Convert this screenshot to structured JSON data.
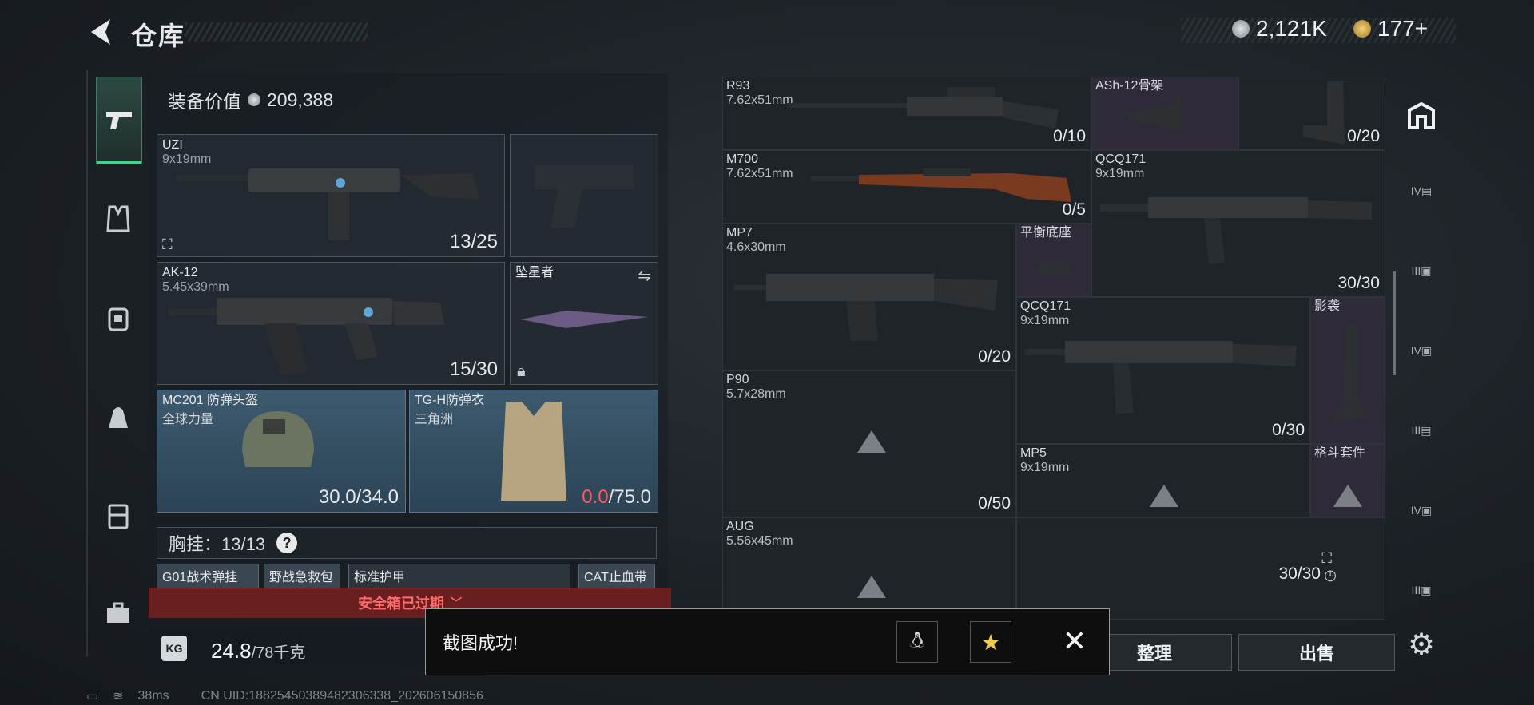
{
  "header": {
    "title": "仓库",
    "silver": "2,121K",
    "gold": "177+"
  },
  "left_panel": {
    "equip_value_label": "装备价值",
    "equip_value": "209,388",
    "slots": {
      "uzi": {
        "name": "UZI",
        "caliber": "9x19mm",
        "count": "13/25"
      },
      "ak12": {
        "name": "AK-12",
        "caliber": "5.45x39mm",
        "count": "15/30"
      },
      "melee": {
        "name": "坠星者"
      },
      "helmet": {
        "name": "MC201 防弹头盔",
        "sub": "全球力量",
        "durability": "30.0",
        "max": "/34.0"
      },
      "armor": {
        "name": "TG-H防弹衣",
        "sub": "三角洲",
        "durability": "0.0",
        "max": "/75.0"
      }
    },
    "chest_rig": "胸挂：13/13",
    "chest_help": "?",
    "chips": [
      "G01战术弹挂",
      "野战急救包",
      "标准护甲",
      "CAT止血带"
    ],
    "safe_box": "安全箱已过期",
    "weight": "24.8",
    "weight_max": "/78千克"
  },
  "grid": {
    "items": [
      {
        "name": "R93",
        "caliber": "7.62x51mm",
        "count": "0/10"
      },
      {
        "name": "ASh-12骨架",
        "caliber": "",
        "count": "0/20"
      },
      {
        "name": "M700",
        "caliber": "7.62x51mm",
        "count": "0/5"
      },
      {
        "name": "QCQ171",
        "caliber": "9x19mm",
        "count": "30/30"
      },
      {
        "name": "MP7",
        "caliber": "4.6x30mm",
        "count": "0/20"
      },
      {
        "name": "平衡底座",
        "caliber": "",
        "count": ""
      },
      {
        "name": "QCQ171",
        "caliber": "9x19mm",
        "count": "0/30"
      },
      {
        "name": "影袭",
        "caliber": "",
        "count": ""
      },
      {
        "name": "P90",
        "caliber": "5.7x28mm",
        "count": "0/50"
      },
      {
        "name": "MP5",
        "caliber": "9x19mm",
        "count": ""
      },
      {
        "name": "格斗套件",
        "caliber": "",
        "count": ""
      },
      {
        "name": "AUG",
        "caliber": "5.56x45mm",
        "count": "30/30"
      }
    ]
  },
  "buttons": {
    "sort": "整理",
    "sell": "出售"
  },
  "toast": {
    "message": "截图成功!"
  },
  "status": {
    "ping": "38ms",
    "uid": "CN UID:18825450389482306338_202606150856"
  },
  "colors": {
    "accent": "#3fd58c",
    "durability_zero": "#ff5a5a",
    "safe_banner": "#ff6b6b"
  },
  "icons": {
    "back": "back-arrow-icon",
    "settings": "gear-icon",
    "close": "close-icon"
  }
}
